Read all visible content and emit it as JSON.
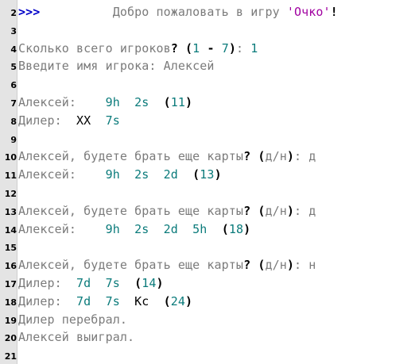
{
  "lines": [
    {
      "n": "2",
      "segments": [
        {
          "t": ">>>",
          "c": "prompt"
        },
        {
          "t": "          Добро пожаловать в игру ",
          "c": "ctext"
        },
        {
          "t": "'Очко'",
          "c": "str"
        },
        {
          "t": "!",
          "c": "kw"
        }
      ]
    },
    {
      "n": "3",
      "segments": []
    },
    {
      "n": "4",
      "segments": [
        {
          "t": "Сколько всего игроков",
          "c": "ctext"
        },
        {
          "t": "?",
          "c": "kw"
        },
        {
          "t": " ",
          "c": "ctext"
        },
        {
          "t": "(",
          "c": "kw"
        },
        {
          "t": "1",
          "c": "num"
        },
        {
          "t": " - ",
          "c": "kw"
        },
        {
          "t": "7",
          "c": "num"
        },
        {
          "t": ")",
          "c": "kw"
        },
        {
          "t": ": ",
          "c": "ctext"
        },
        {
          "t": "1",
          "c": "num"
        }
      ]
    },
    {
      "n": "5",
      "segments": [
        {
          "t": "Введите имя игрока: Алексей",
          "c": "ctext"
        }
      ]
    },
    {
      "n": "6",
      "segments": []
    },
    {
      "n": "7",
      "segments": [
        {
          "t": "Алексей:    ",
          "c": "ctext"
        },
        {
          "t": "9h  2s",
          "c": "card"
        },
        {
          "t": "  ",
          "c": "ctext"
        },
        {
          "t": "(",
          "c": "kw"
        },
        {
          "t": "11",
          "c": "num"
        },
        {
          "t": ")",
          "c": "kw"
        }
      ]
    },
    {
      "n": "8",
      "segments": [
        {
          "t": "Дилер:  ",
          "c": "ctext"
        },
        {
          "t": "XX",
          "c": "pl"
        },
        {
          "t": "  ",
          "c": "ctext"
        },
        {
          "t": "7s",
          "c": "card"
        }
      ]
    },
    {
      "n": "9",
      "segments": []
    },
    {
      "n": "10",
      "segments": [
        {
          "t": "Алексей, будете брать еще карты",
          "c": "ctext"
        },
        {
          "t": "?",
          "c": "kw"
        },
        {
          "t": " ",
          "c": "ctext"
        },
        {
          "t": "(",
          "c": "kw"
        },
        {
          "t": "д/н",
          "c": "ctext"
        },
        {
          "t": ")",
          "c": "kw"
        },
        {
          "t": ": д",
          "c": "ctext"
        }
      ]
    },
    {
      "n": "11",
      "segments": [
        {
          "t": "Алексей:    ",
          "c": "ctext"
        },
        {
          "t": "9h  2s  2d",
          "c": "card"
        },
        {
          "t": "  ",
          "c": "ctext"
        },
        {
          "t": "(",
          "c": "kw"
        },
        {
          "t": "13",
          "c": "num"
        },
        {
          "t": ")",
          "c": "kw"
        }
      ]
    },
    {
      "n": "12",
      "segments": []
    },
    {
      "n": "13",
      "segments": [
        {
          "t": "Алексей, будете брать еще карты",
          "c": "ctext"
        },
        {
          "t": "?",
          "c": "kw"
        },
        {
          "t": " ",
          "c": "ctext"
        },
        {
          "t": "(",
          "c": "kw"
        },
        {
          "t": "д/н",
          "c": "ctext"
        },
        {
          "t": ")",
          "c": "kw"
        },
        {
          "t": ": д",
          "c": "ctext"
        }
      ]
    },
    {
      "n": "14",
      "segments": [
        {
          "t": "Алексей:    ",
          "c": "ctext"
        },
        {
          "t": "9h  2s  2d  5h",
          "c": "card"
        },
        {
          "t": "  ",
          "c": "ctext"
        },
        {
          "t": "(",
          "c": "kw"
        },
        {
          "t": "18",
          "c": "num"
        },
        {
          "t": ")",
          "c": "kw"
        }
      ]
    },
    {
      "n": "15",
      "segments": []
    },
    {
      "n": "16",
      "segments": [
        {
          "t": "Алексей, будете брать еще карты",
          "c": "ctext"
        },
        {
          "t": "?",
          "c": "kw"
        },
        {
          "t": " ",
          "c": "ctext"
        },
        {
          "t": "(",
          "c": "kw"
        },
        {
          "t": "д/н",
          "c": "ctext"
        },
        {
          "t": ")",
          "c": "kw"
        },
        {
          "t": ": н",
          "c": "ctext"
        }
      ]
    },
    {
      "n": "17",
      "segments": [
        {
          "t": "Дилер:  ",
          "c": "ctext"
        },
        {
          "t": "7d  7s",
          "c": "card"
        },
        {
          "t": "  ",
          "c": "ctext"
        },
        {
          "t": "(",
          "c": "kw"
        },
        {
          "t": "14",
          "c": "num"
        },
        {
          "t": ")",
          "c": "kw"
        }
      ]
    },
    {
      "n": "18",
      "segments": [
        {
          "t": "Дилер:  ",
          "c": "ctext"
        },
        {
          "t": "7d  7s",
          "c": "card"
        },
        {
          "t": "  ",
          "c": "ctext"
        },
        {
          "t": "Kc",
          "c": "pl"
        },
        {
          "t": "  ",
          "c": "ctext"
        },
        {
          "t": "(",
          "c": "kw"
        },
        {
          "t": "24",
          "c": "num"
        },
        {
          "t": ")",
          "c": "kw"
        }
      ]
    },
    {
      "n": "19",
      "segments": [
        {
          "t": "Дилер перебрал.",
          "c": "ctext"
        }
      ]
    },
    {
      "n": "20",
      "segments": [
        {
          "t": "Алексей выиграл.",
          "c": "ctext"
        }
      ]
    },
    {
      "n": "21",
      "segments": []
    }
  ],
  "colors": {
    "prompt": "#0000c8",
    "text": "#7b7b7b",
    "string": "#a000a0",
    "number": "#0b7b7b",
    "gutter": "#e4e4e4"
  }
}
